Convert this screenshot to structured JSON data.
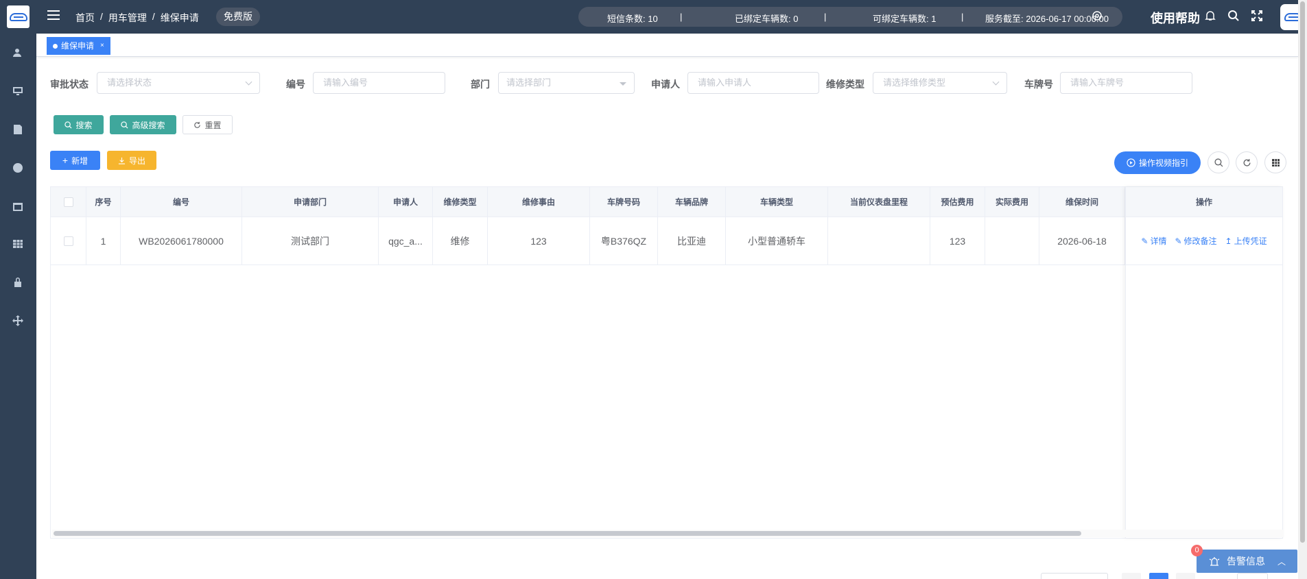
{
  "topbar": {
    "breadcrumb": [
      "首页",
      "用车管理",
      "维保申请"
    ],
    "breadcrumb_sep": "/",
    "plan_badge": "免费版",
    "sms_count": "短信条数: 10",
    "bound_vehicles": "已绑定车辆数: 0",
    "bindable_vehicles": "可绑定车辆数: 1",
    "service_until": "服务截至: 2026-06-17 00:00:00",
    "divider": "|",
    "help_label": "使用帮助"
  },
  "tagsview": {
    "active_tag": "维保申请",
    "close_glyph": "×"
  },
  "filters": {
    "approval_status": {
      "label": "审批状态",
      "placeholder": "请选择状态"
    },
    "code": {
      "label": "编号",
      "placeholder": "请输入编号"
    },
    "department": {
      "label": "部门",
      "placeholder": "请选择部门"
    },
    "applicant": {
      "label": "申请人",
      "placeholder": "请输入申请人"
    },
    "repair_type": {
      "label": "维修类型",
      "placeholder": "请选择维修类型"
    },
    "plate": {
      "label": "车牌号",
      "placeholder": "请输入车牌号"
    }
  },
  "actions": {
    "search": "搜索",
    "advanced_search": "高级搜索",
    "reset": "重置",
    "add": "新增",
    "export": "导出",
    "video_guide": "操作视频指引"
  },
  "table": {
    "headers": [
      "序号",
      "编号",
      "申请部门",
      "申请人",
      "维修类型",
      "维修事由",
      "车牌号码",
      "车辆品牌",
      "车辆类型",
      "当前仪表盘里程",
      "预估费用",
      "实际费用",
      "维保时间",
      "操作"
    ],
    "rows": [
      {
        "index": "1",
        "code": "WB2026061780000",
        "department": "测试部门",
        "applicant": "qgc_a...",
        "repair_type": "维修",
        "reason": "123",
        "plate": "粤B376QZ",
        "brand": "比亚迪",
        "vehicle_type": "小型普通轿车",
        "mileage": "",
        "est_cost": "123",
        "actual_cost": "",
        "date": "2026-06-18",
        "ops": [
          "详情",
          "修改备注",
          "上传凭证"
        ]
      }
    ]
  },
  "alarm": {
    "label": "告警信息",
    "count": "0"
  }
}
